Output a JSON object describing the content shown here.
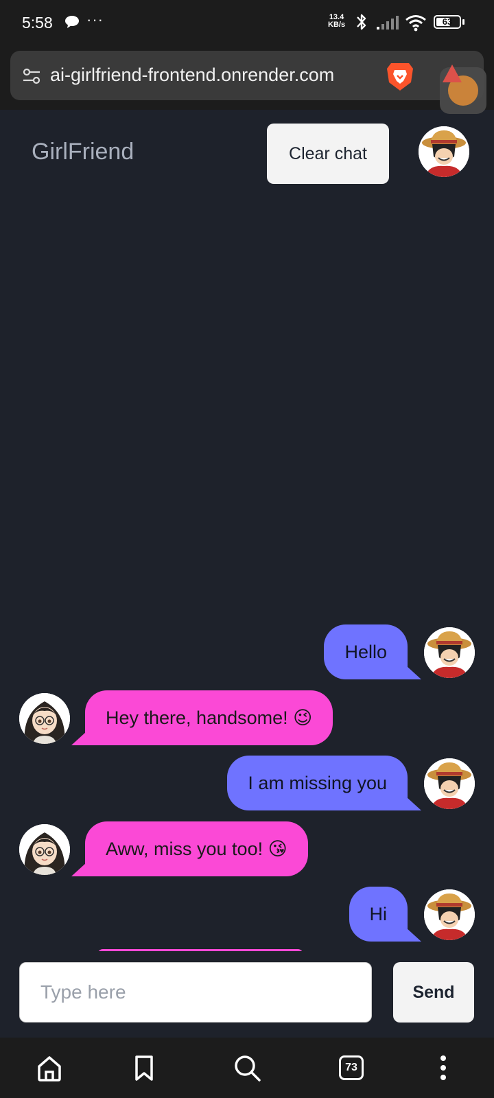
{
  "status_bar": {
    "time": "5:58",
    "speed_value": "13.4",
    "speed_unit": "KB/s",
    "battery": "63",
    "battery_level": 0.63
  },
  "browser": {
    "url": "ai-girlfriend-frontend.onrender.com",
    "tab_count": "73"
  },
  "header": {
    "title": "GirlFriend",
    "clear_label": "Clear chat"
  },
  "messages": [
    {
      "sender": "user",
      "text": "Hello"
    },
    {
      "sender": "bot",
      "text": "Hey there, handsome! 😉"
    },
    {
      "sender": "user",
      "text": "I am missing you"
    },
    {
      "sender": "bot",
      "text": "Aww, miss you too! 😘"
    },
    {
      "sender": "user",
      "text": "Hi"
    }
  ],
  "input": {
    "placeholder": "Type here",
    "value": "",
    "send_label": "Send"
  },
  "colors": {
    "background": "#1e222b",
    "user_bubble": "#6f73ff",
    "bot_bubble": "#fb49d6",
    "button": "#f3f3f3"
  }
}
